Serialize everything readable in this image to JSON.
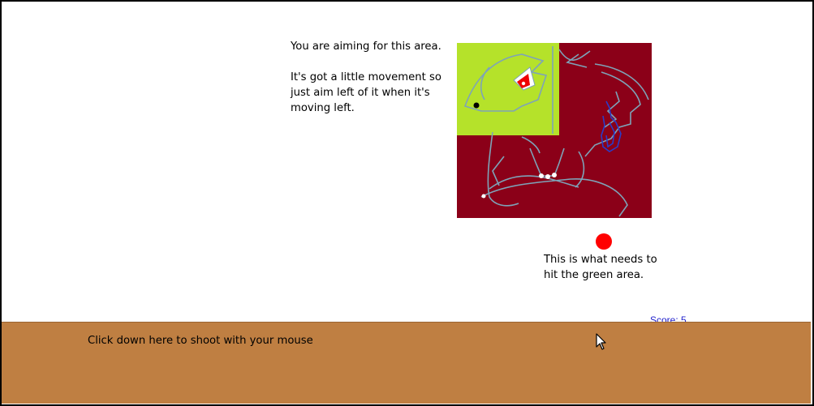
{
  "instructions": {
    "aim_text": "You are aiming for this area.\n\nIt's got a little movement so just aim left of it when it's moving left."
  },
  "target": {
    "icon": "dragon-head-target-icon",
    "colors": {
      "background": "#8b0018",
      "target_zone": "#b5e22a"
    }
  },
  "ball": {
    "color": "#ff0000",
    "caption": "This is what needs to hit the green area."
  },
  "score": {
    "text": "Score: 5"
  },
  "ground": {
    "label": "Click down here to shoot with your mouse",
    "color": "#bf7f42"
  },
  "cursor": {
    "icon": "mouse-pointer-icon"
  }
}
